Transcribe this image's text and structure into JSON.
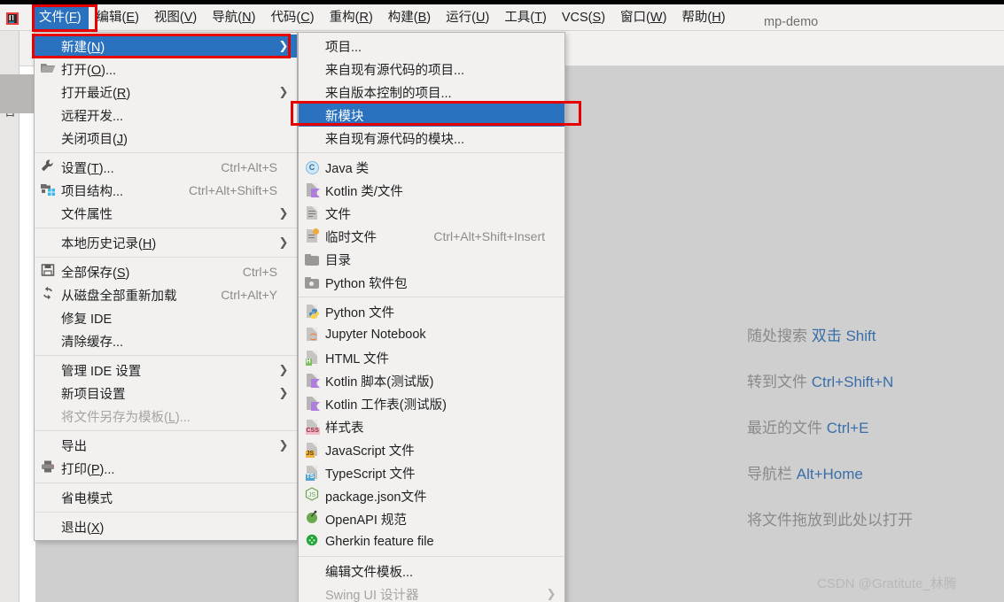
{
  "window": {
    "project_title": "mp-demo",
    "app_icon": "intellij-idea-icon",
    "left_tool_label": "项目"
  },
  "menubar": {
    "items": [
      {
        "label": "文件(F)",
        "mnemonic": "F",
        "active": true
      },
      {
        "label": "编辑(E)",
        "mnemonic": "E",
        "active": false
      },
      {
        "label": "视图(V)",
        "mnemonic": "V",
        "active": false
      },
      {
        "label": "导航(N)",
        "mnemonic": "N",
        "active": false
      },
      {
        "label": "代码(C)",
        "mnemonic": "C",
        "active": false
      },
      {
        "label": "重构(R)",
        "mnemonic": "R",
        "active": false
      },
      {
        "label": "构建(B)",
        "mnemonic": "B",
        "active": false
      },
      {
        "label": "运行(U)",
        "mnemonic": "U",
        "active": false
      },
      {
        "label": "工具(T)",
        "mnemonic": "T",
        "active": false
      },
      {
        "label": "VCS(S)",
        "mnemonic": "S",
        "active": false
      },
      {
        "label": "窗口(W)",
        "mnemonic": "W",
        "active": false
      },
      {
        "label": "帮助(H)",
        "mnemonic": "H",
        "active": false
      }
    ]
  },
  "file_menu": {
    "rows": [
      {
        "type": "item",
        "label": "新建(N)",
        "icon": "",
        "accel": "",
        "arrow": true,
        "selected": true,
        "disabled": false
      },
      {
        "type": "item",
        "label": "打开(O)...",
        "icon": "folder-open-icon",
        "accel": "",
        "arrow": false,
        "selected": false,
        "disabled": false
      },
      {
        "type": "item",
        "label": "打开最近(R)",
        "icon": "",
        "accel": "",
        "arrow": true,
        "selected": false,
        "disabled": false
      },
      {
        "type": "item",
        "label": "远程开发...",
        "icon": "",
        "accel": "",
        "arrow": false,
        "selected": false,
        "disabled": false
      },
      {
        "type": "item",
        "label": "关闭项目(J)",
        "icon": "",
        "accel": "",
        "arrow": false,
        "selected": false,
        "disabled": false
      },
      {
        "type": "sep"
      },
      {
        "type": "item",
        "label": "设置(T)...",
        "icon": "wrench-icon",
        "accel": "Ctrl+Alt+S",
        "arrow": false,
        "selected": false,
        "disabled": false
      },
      {
        "type": "item",
        "label": "项目结构...",
        "icon": "project-structure-icon",
        "accel": "Ctrl+Alt+Shift+S",
        "arrow": false,
        "selected": false,
        "disabled": false
      },
      {
        "type": "item",
        "label": "文件属性",
        "icon": "",
        "accel": "",
        "arrow": true,
        "selected": false,
        "disabled": false
      },
      {
        "type": "sep"
      },
      {
        "type": "item",
        "label": "本地历史记录(H)",
        "icon": "",
        "accel": "",
        "arrow": true,
        "selected": false,
        "disabled": false
      },
      {
        "type": "sep"
      },
      {
        "type": "item",
        "label": "全部保存(S)",
        "icon": "save-icon",
        "accel": "Ctrl+S",
        "arrow": false,
        "selected": false,
        "disabled": false
      },
      {
        "type": "item",
        "label": "从磁盘全部重新加载",
        "icon": "reload-icon",
        "accel": "Ctrl+Alt+Y",
        "arrow": false,
        "selected": false,
        "disabled": false
      },
      {
        "type": "item",
        "label": "修复 IDE",
        "icon": "",
        "accel": "",
        "arrow": false,
        "selected": false,
        "disabled": false
      },
      {
        "type": "item",
        "label": "清除缓存...",
        "icon": "",
        "accel": "",
        "arrow": false,
        "selected": false,
        "disabled": false
      },
      {
        "type": "sep"
      },
      {
        "type": "item",
        "label": "管理 IDE 设置",
        "icon": "",
        "accel": "",
        "arrow": true,
        "selected": false,
        "disabled": false
      },
      {
        "type": "item",
        "label": "新项目设置",
        "icon": "",
        "accel": "",
        "arrow": true,
        "selected": false,
        "disabled": false
      },
      {
        "type": "item",
        "label": "将文件另存为模板(L)...",
        "icon": "",
        "accel": "",
        "arrow": false,
        "selected": false,
        "disabled": true
      },
      {
        "type": "sep"
      },
      {
        "type": "item",
        "label": "导出",
        "icon": "",
        "accel": "",
        "arrow": true,
        "selected": false,
        "disabled": false
      },
      {
        "type": "item",
        "label": "打印(P)...",
        "icon": "printer-icon",
        "accel": "",
        "arrow": false,
        "selected": false,
        "disabled": false
      },
      {
        "type": "sep"
      },
      {
        "type": "item",
        "label": "省电模式",
        "icon": "",
        "accel": "",
        "arrow": false,
        "selected": false,
        "disabled": false
      },
      {
        "type": "sep"
      },
      {
        "type": "item",
        "label": "退出(X)",
        "icon": "",
        "accel": "",
        "arrow": false,
        "selected": false,
        "disabled": false
      }
    ]
  },
  "new_submenu": {
    "rows": [
      {
        "type": "item",
        "label": "项目...",
        "icon": "",
        "accel": "",
        "arrow": false,
        "selected": false,
        "disabled": false
      },
      {
        "type": "item",
        "label": "来自现有源代码的项目...",
        "icon": "",
        "accel": "",
        "arrow": false,
        "selected": false,
        "disabled": false
      },
      {
        "type": "item",
        "label": "来自版本控制的项目...",
        "icon": "",
        "accel": "",
        "arrow": false,
        "selected": false,
        "disabled": false
      },
      {
        "type": "item",
        "label": "新模块",
        "icon": "",
        "accel": "",
        "arrow": false,
        "selected": true,
        "disabled": false
      },
      {
        "type": "item",
        "label": "来自现有源代码的模块...",
        "icon": "",
        "accel": "",
        "arrow": false,
        "selected": false,
        "disabled": false
      },
      {
        "type": "sep"
      },
      {
        "type": "item",
        "label": "Java 类",
        "icon": "java-class-icon",
        "accel": "",
        "arrow": false,
        "selected": false,
        "disabled": false
      },
      {
        "type": "item",
        "label": "Kotlin 类/文件",
        "icon": "kotlin-file-icon",
        "accel": "",
        "arrow": false,
        "selected": false,
        "disabled": false
      },
      {
        "type": "item",
        "label": "文件",
        "icon": "plain-file-icon",
        "accel": "",
        "arrow": false,
        "selected": false,
        "disabled": false
      },
      {
        "type": "item",
        "label": "临时文件",
        "icon": "scratch-file-icon",
        "accel": "Ctrl+Alt+Shift+Insert",
        "arrow": false,
        "selected": false,
        "disabled": false
      },
      {
        "type": "item",
        "label": "目录",
        "icon": "directory-icon",
        "accel": "",
        "arrow": false,
        "selected": false,
        "disabled": false
      },
      {
        "type": "item",
        "label": "Python 软件包",
        "icon": "python-package-icon",
        "accel": "",
        "arrow": false,
        "selected": false,
        "disabled": false
      },
      {
        "type": "sep"
      },
      {
        "type": "item",
        "label": "Python 文件",
        "icon": "python-file-icon",
        "accel": "",
        "arrow": false,
        "selected": false,
        "disabled": false
      },
      {
        "type": "item",
        "label": "Jupyter Notebook",
        "icon": "jupyter-icon",
        "accel": "",
        "arrow": false,
        "selected": false,
        "disabled": false
      },
      {
        "type": "item",
        "label": "HTML 文件",
        "icon": "html-file-icon",
        "accel": "",
        "arrow": false,
        "selected": false,
        "disabled": false
      },
      {
        "type": "item",
        "label": "Kotlin 脚本(测试版)",
        "icon": "kotlin-script-icon",
        "accel": "",
        "arrow": false,
        "selected": false,
        "disabled": false
      },
      {
        "type": "item",
        "label": "Kotlin 工作表(测试版)",
        "icon": "kotlin-worksheet-icon",
        "accel": "",
        "arrow": false,
        "selected": false,
        "disabled": false
      },
      {
        "type": "item",
        "label": "样式表",
        "icon": "css-file-icon",
        "accel": "",
        "arrow": false,
        "selected": false,
        "disabled": false
      },
      {
        "type": "item",
        "label": "JavaScript 文件",
        "icon": "js-file-icon",
        "accel": "",
        "arrow": false,
        "selected": false,
        "disabled": false
      },
      {
        "type": "item",
        "label": "TypeScript 文件",
        "icon": "ts-file-icon",
        "accel": "",
        "arrow": false,
        "selected": false,
        "disabled": false
      },
      {
        "type": "item",
        "label": "package.json文件",
        "icon": "nodejs-icon",
        "accel": "",
        "arrow": false,
        "selected": false,
        "disabled": false
      },
      {
        "type": "item",
        "label": "OpenAPI 规范",
        "icon": "openapi-icon",
        "accel": "",
        "arrow": false,
        "selected": false,
        "disabled": false
      },
      {
        "type": "item",
        "label": "Gherkin feature file",
        "icon": "cucumber-icon",
        "accel": "",
        "arrow": false,
        "selected": false,
        "disabled": false
      },
      {
        "type": "sep"
      },
      {
        "type": "item",
        "label": "编辑文件模板...",
        "icon": "",
        "accel": "",
        "arrow": false,
        "selected": false,
        "disabled": false
      },
      {
        "type": "item",
        "label": "Swing UI 设计器",
        "icon": "",
        "accel": "",
        "arrow": true,
        "selected": false,
        "disabled": true
      }
    ]
  },
  "editor_hints": [
    {
      "text": "随处搜索 ",
      "key": "双击 Shift"
    },
    {
      "text": "转到文件 ",
      "key": "Ctrl+Shift+N"
    },
    {
      "text": "最近的文件 ",
      "key": "Ctrl+E"
    },
    {
      "text": "导航栏 ",
      "key": "Alt+Home"
    },
    {
      "text": "将文件拖放到此处以打开",
      "key": ""
    }
  ],
  "watermark": "CSDN @Gratitute_林腾",
  "colors": {
    "selection_blue": "#2a72c0",
    "highlight_red": "#e60000",
    "menu_bg": "#f2f1f0",
    "editor_bg": "#cfcfcf",
    "hint_key_blue": "#3a6ea8",
    "hint_text_gray": "#8a8a8a"
  }
}
